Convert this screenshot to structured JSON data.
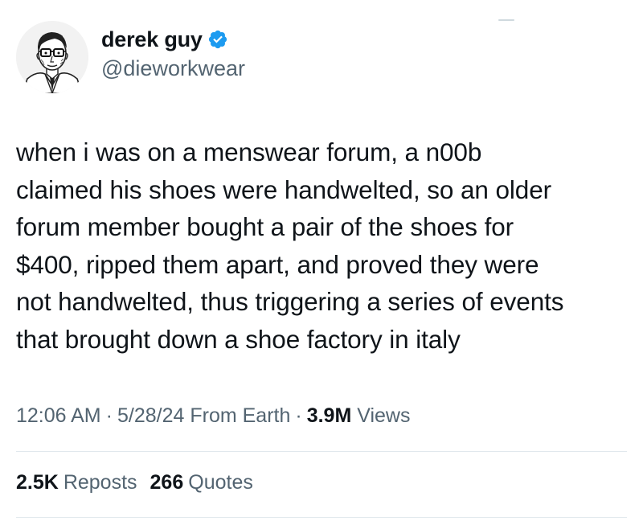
{
  "colors": {
    "verified_badge": "#1d9bf0",
    "text_primary": "#0f1419",
    "text_secondary": "#536471",
    "divider": "#e1e8ed"
  },
  "author": {
    "display_name": "derek guy",
    "handle": "@dieworkwear",
    "verified": true,
    "verified_icon": "verified-badge-icon",
    "avatar_icon": "illustrated-portrait-avatar"
  },
  "tweet": {
    "text": "when i was on a menswear forum, a n00b\nclaimed his shoes were handwelted, so an older\nforum member bought a pair of the shoes for\n$400, ripped them apart, and proved they were\nnot handwelted, thus triggering a series of events\nthat brought down a shoe factory in italy",
    "time": "12:06 AM",
    "date": "5/28/24",
    "source": "From Earth",
    "separator": "·",
    "views_count": "3.9M",
    "views_label": "Views"
  },
  "stats": {
    "reposts_count": "2.5K",
    "reposts_label": "Reposts",
    "quotes_count": "266",
    "quotes_label": "Quotes"
  }
}
